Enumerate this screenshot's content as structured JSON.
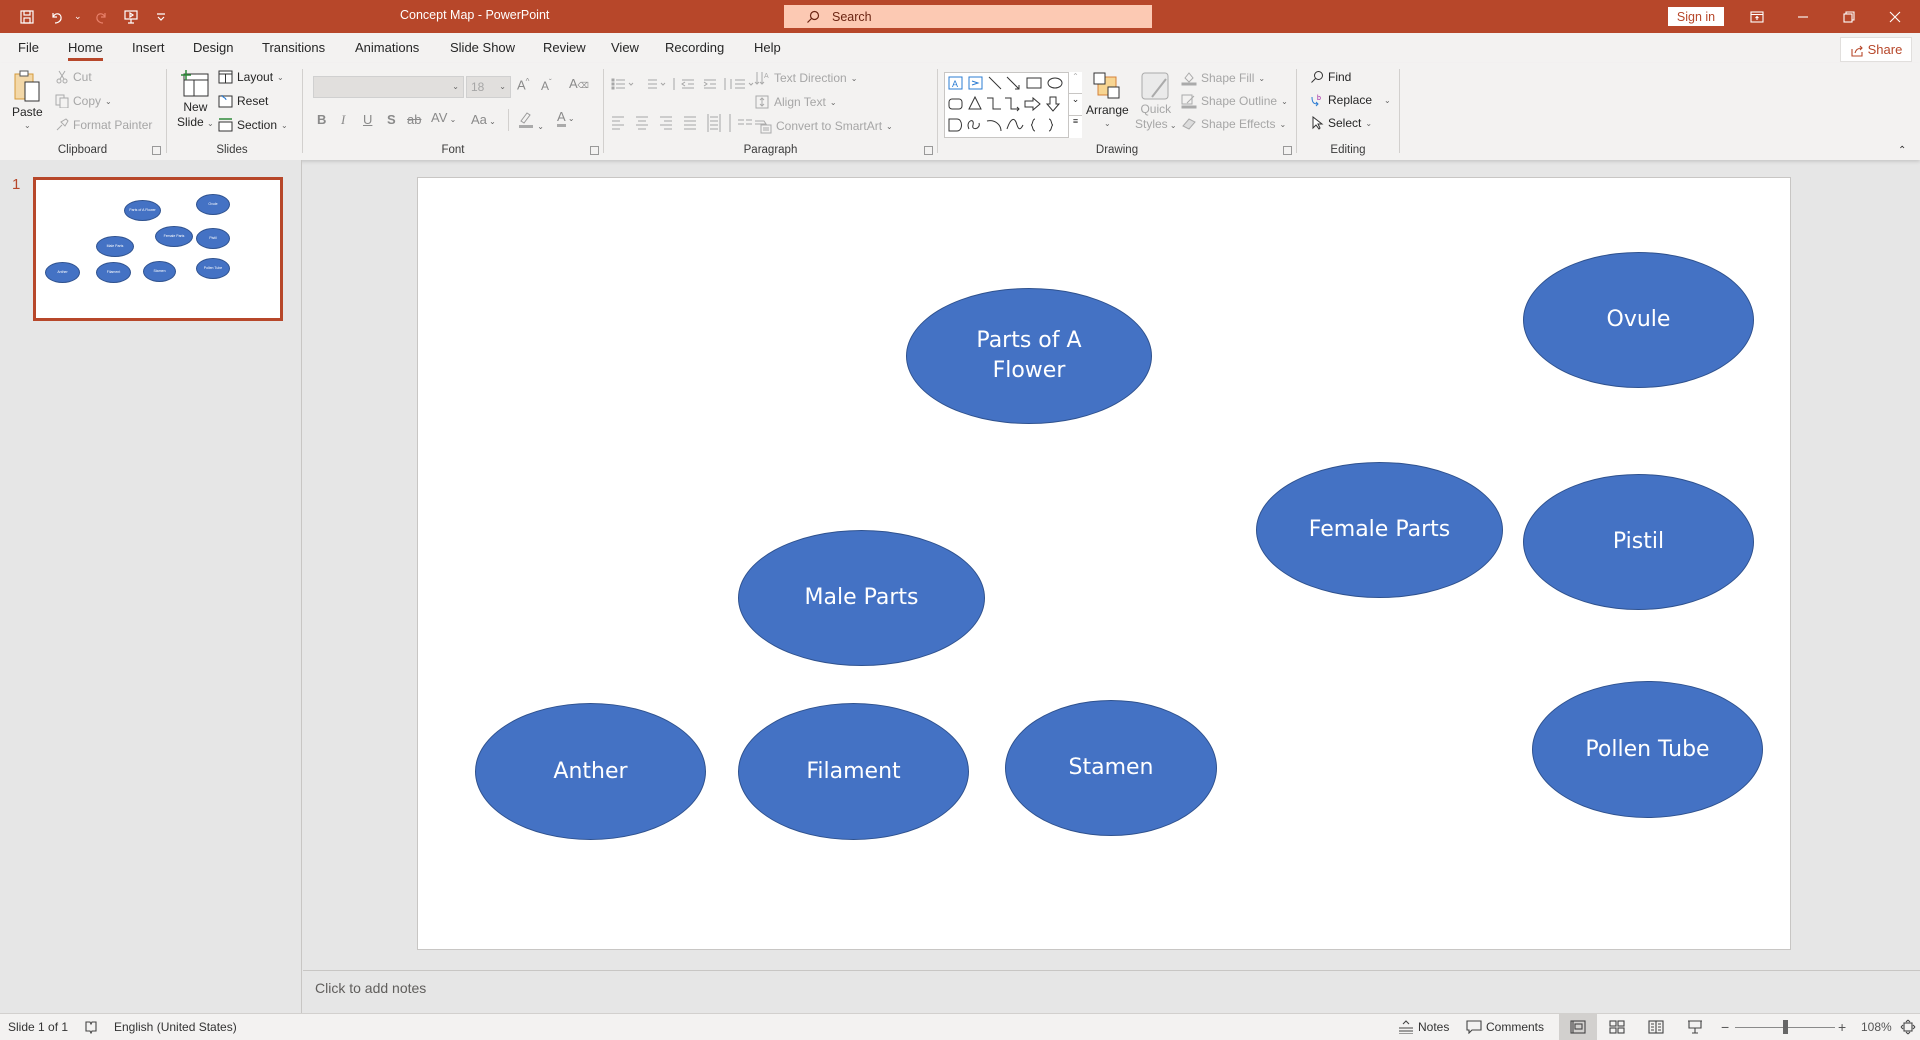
{
  "app": {
    "title": "Concept Map  -  PowerPoint",
    "search_placeholder": "Search",
    "sign_in": "Sign in",
    "share": "Share"
  },
  "tabs": [
    {
      "label": "File"
    },
    {
      "label": "Home",
      "active": true
    },
    {
      "label": "Insert"
    },
    {
      "label": "Design"
    },
    {
      "label": "Transitions"
    },
    {
      "label": "Animations"
    },
    {
      "label": "Slide Show"
    },
    {
      "label": "Review"
    },
    {
      "label": "View"
    },
    {
      "label": "Recording"
    },
    {
      "label": "Help"
    }
  ],
  "ribbon": {
    "clipboard": {
      "label": "Clipboard",
      "paste": "Paste",
      "cut": "Cut",
      "copy": "Copy",
      "format_painter": "Format Painter"
    },
    "slides": {
      "label": "Slides",
      "new_slide_1": "New",
      "new_slide_2": "Slide",
      "layout": "Layout",
      "reset": "Reset",
      "section": "Section"
    },
    "font": {
      "label": "Font",
      "font_name": "",
      "font_size": "18",
      "bold": "B",
      "italic": "I",
      "underline": "U",
      "shadow": "S",
      "strike": "ab",
      "spacing": "AV",
      "case": "Aa",
      "grow": "A",
      "shrink": "A"
    },
    "paragraph": {
      "label": "Paragraph",
      "text_direction": "Text Direction",
      "align_text": "Align Text",
      "convert_smartart": "Convert to SmartArt"
    },
    "drawing": {
      "label": "Drawing",
      "arrange": "Arrange",
      "quick_styles_1": "Quick",
      "quick_styles_2": "Styles",
      "shape_fill": "Shape Fill",
      "shape_outline": "Shape Outline",
      "shape_effects": "Shape Effects"
    },
    "editing": {
      "label": "Editing",
      "find": "Find",
      "replace": "Replace",
      "select": "Select"
    }
  },
  "thumbnails": [
    {
      "number": "1",
      "selected": true
    }
  ],
  "slide": {
    "shapes": [
      {
        "id": "parts-of-a-flower",
        "text": "Parts of A Flower",
        "line1": "Parts of A",
        "line2": "Flower"
      },
      {
        "id": "ovule",
        "text": "Ovule"
      },
      {
        "id": "female-parts",
        "text": "Female Parts"
      },
      {
        "id": "pistil",
        "text": "Pistil"
      },
      {
        "id": "male-parts",
        "text": "Male Parts"
      },
      {
        "id": "anther",
        "text": "Anther"
      },
      {
        "id": "filament",
        "text": "Filament"
      },
      {
        "id": "stamen",
        "text": "Stamen"
      },
      {
        "id": "pollen-tube",
        "text": "Pollen Tube"
      }
    ],
    "shape_fill": "#4472C4",
    "shape_outline": "#2F528F"
  },
  "notes": {
    "placeholder": "Click to add notes"
  },
  "status": {
    "slide_info": "Slide 1 of 1",
    "language": "English (United States)",
    "notes": "Notes",
    "comments": "Comments",
    "zoom_level": "108%",
    "zoom_minus": "−",
    "zoom_plus": "+"
  }
}
